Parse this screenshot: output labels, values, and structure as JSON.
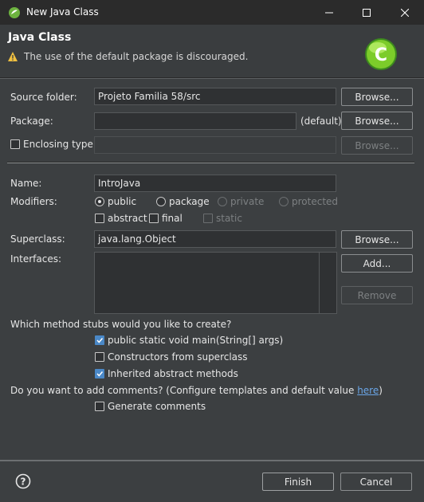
{
  "window": {
    "title": "New Java Class",
    "minimize_icon": "minimize-icon",
    "maximize_icon": "maximize-icon",
    "close_icon": "close-icon"
  },
  "banner": {
    "title": "Java Class",
    "warning": "The use of the default package is discouraged.",
    "big_icon": "new-class-c-icon"
  },
  "source_folder": {
    "label": "Source folder:",
    "value": "Projeto Familia 58/src",
    "browse": "Browse..."
  },
  "package": {
    "label": "Package:",
    "value": "",
    "suffix": "(default)",
    "browse": "Browse..."
  },
  "enclosing": {
    "label": "Enclosing type:",
    "checked": false,
    "value": "",
    "browse": "Browse..."
  },
  "name": {
    "label": "Name:",
    "value": "IntroJava"
  },
  "modifiers": {
    "label": "Modifiers:",
    "access": [
      {
        "label": "public",
        "checked": true,
        "enabled": true
      },
      {
        "label": "package",
        "checked": false,
        "enabled": true
      },
      {
        "label": "private",
        "checked": false,
        "enabled": false
      },
      {
        "label": "protected",
        "checked": false,
        "enabled": false
      }
    ],
    "flags": [
      {
        "label": "abstract",
        "checked": false,
        "enabled": true
      },
      {
        "label": "final",
        "checked": false,
        "enabled": true
      },
      {
        "label": "static",
        "checked": false,
        "enabled": false
      }
    ]
  },
  "superclass": {
    "label": "Superclass:",
    "value": "java.lang.Object",
    "browse": "Browse..."
  },
  "interfaces": {
    "label": "Interfaces:",
    "add": "Add...",
    "remove": "Remove"
  },
  "stubs": {
    "question": "Which method stubs would you like to create?",
    "options": [
      {
        "label": "public static void main(String[] args)",
        "checked": true
      },
      {
        "label": "Constructors from superclass",
        "checked": false
      },
      {
        "label": "Inherited abstract methods",
        "checked": true
      }
    ]
  },
  "comments": {
    "question": "Do you want to add comments? (Configure templates and default value ",
    "link": "here",
    "close_paren": ")",
    "option": {
      "label": "Generate comments",
      "checked": false
    }
  },
  "footer": {
    "help_icon": "help-icon",
    "finish": "Finish",
    "cancel": "Cancel"
  },
  "colors": {
    "background": "#3c3f41",
    "titlebar": "#2b2b2b",
    "accent": "#4a88c7",
    "link": "#6aa6e8"
  }
}
